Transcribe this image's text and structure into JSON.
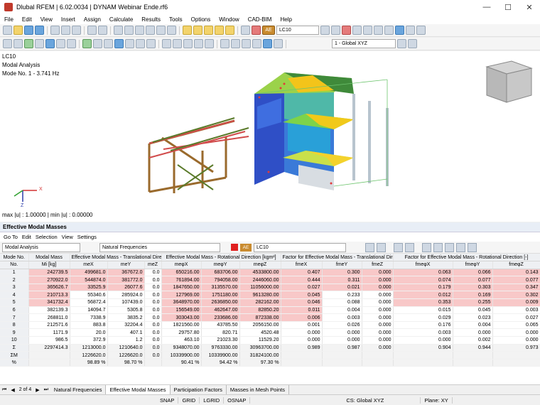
{
  "window": {
    "title": "Dlubal RFEM | 6.02.0034 | DYNAM Webinar Ende.rf6",
    "min": "—",
    "max": "☐",
    "close": "✕"
  },
  "menu": [
    "File",
    "Edit",
    "View",
    "Insert",
    "Assign",
    "Calculate",
    "Results",
    "Tools",
    "Options",
    "Window",
    "CAD-BIM",
    "Help"
  ],
  "toolbar": {
    "ae_badge": "AE",
    "load_case": "LC10",
    "coord_system": "1 - Global XYZ"
  },
  "view": {
    "lc": "LC10",
    "analysis": "Modal Analysis",
    "mode": "Mode No. 1 - 3.741 Hz",
    "max_min": "max |u| : 1.00000 | min |u| : 0.00000",
    "axis_x": "X",
    "axis_z": "Z"
  },
  "table_panel": {
    "title": "Effective Modal Masses",
    "menu": [
      "Go To",
      "Edit",
      "Selection",
      "View",
      "Settings"
    ],
    "analysis_dd": "Modal Analysis",
    "result_dd": "Natural Frequencies",
    "ae_badge": "AE",
    "lc_dd": "LC10",
    "group_headers": [
      "Mode No.",
      "Modal Mass",
      "Effective Modal Mass - Translational Direction [kg]",
      "Effective Modal Mass - Rotational Direction [kgm²]",
      "Factor for Effective Modal Mass - Translational Direction [-]",
      "Factor for Effective Modal Mass - Rotational Direction [-]"
    ],
    "columns": [
      "No.",
      "Mi [kg]",
      "meX",
      "meY",
      "meZ",
      "meφX",
      "meφY",
      "meφZ",
      "fmeX",
      "fmeY",
      "fmeZ",
      "fmeφX",
      "fmeφY",
      "fmeφZ"
    ],
    "rows": [
      [
        "1",
        "242739.5",
        "499681.0",
        "367672.0",
        "0.0",
        "650216.00",
        "683706.00",
        "4533800.00",
        "0.407",
        "0.300",
        "0.000",
        "0.063",
        "0.066",
        "0.143"
      ],
      [
        "2",
        "270922.0",
        "544874.0",
        "381772.0",
        "0.0",
        "761894.00",
        "794058.00",
        "2446060.00",
        "0.444",
        "0.311",
        "0.000",
        "0.074",
        "0.077",
        "0.077"
      ],
      [
        "3",
        "365626.7",
        "33525.9",
        "26077.6",
        "0.0",
        "1847650.00",
        "3135570.00",
        "11056000.00",
        "0.027",
        "0.021",
        "0.000",
        "0.179",
        "0.303",
        "0.347"
      ],
      [
        "4",
        "210713.3",
        "55340.6",
        "285924.0",
        "0.0",
        "127969.00",
        "1751180.00",
        "9613280.00",
        "0.045",
        "0.233",
        "0.000",
        "0.012",
        "0.169",
        "0.302"
      ],
      [
        "5",
        "341732.4",
        "56872.4",
        "107439.0",
        "0.0",
        "3648970.00",
        "2636850.00",
        "282162.00",
        "0.046",
        "0.088",
        "0.000",
        "0.353",
        "0.255",
        "0.009"
      ],
      [
        "6",
        "382139.3",
        "14094.7",
        "5305.8",
        "0.0",
        "156549.00",
        "462647.00",
        "82850.20",
        "0.011",
        "0.004",
        "0.000",
        "0.015",
        "0.045",
        "0.003"
      ],
      [
        "7",
        "268811.0",
        "7338.9",
        "3835.2",
        "0.0",
        "303043.00",
        "233686.00",
        "872338.00",
        "0.006",
        "0.003",
        "0.000",
        "0.029",
        "0.023",
        "0.027"
      ],
      [
        "8",
        "212571.6",
        "883.8",
        "32204.4",
        "0.0",
        "1821560.00",
        "43785.50",
        "2056150.00",
        "0.001",
        "0.026",
        "0.000",
        "0.176",
        "0.004",
        "0.065"
      ],
      [
        "9",
        "1171.9",
        "20.0",
        "407.1",
        "0.0",
        "29757.80",
        "820.71",
        "4520.48",
        "0.000",
        "0.000",
        "0.000",
        "0.003",
        "0.000",
        "0.000"
      ],
      [
        "10",
        "986.5",
        "372.9",
        "1.2",
        "0.0",
        "463.10",
        "21023.30",
        "11529.20",
        "0.000",
        "0.000",
        "0.000",
        "0.000",
        "0.002",
        "0.000"
      ]
    ],
    "summary": [
      [
        "Σ",
        "2297414.3",
        "1213000.0",
        "1210640.0",
        "0.0",
        "9348070.00",
        "9763330.00",
        "30963700.00",
        "0.989",
        "0.987",
        "0.000",
        "0.904",
        "0.944",
        "0.973"
      ],
      [
        "ΣM",
        "",
        "1226620.0",
        "1226620.0",
        "0.0",
        "10339900.00",
        "10339900.00",
        "31824100.00",
        "",
        "",
        "",
        "",
        "",
        ""
      ],
      [
        "%",
        "",
        "98.89 %",
        "98.70 %",
        "",
        "90.41 %",
        "94.42 %",
        "97.30 %",
        "",
        "",
        "",
        "",
        "",
        ""
      ]
    ]
  },
  "sheet_tabs": {
    "page": "2 of 4",
    "tabs": [
      "Natural Frequencies",
      "Effective Modal Masses",
      "Participation Factors",
      "Masses in Mesh Points"
    ],
    "active": 1
  },
  "status": [
    "SNAP",
    "GRID",
    "LGRID",
    "OSNAP",
    "CS: Global XYZ",
    "Plane: XY"
  ],
  "colors": {
    "accent": "#1e5aa8",
    "highlight": "#f8c8c8"
  }
}
